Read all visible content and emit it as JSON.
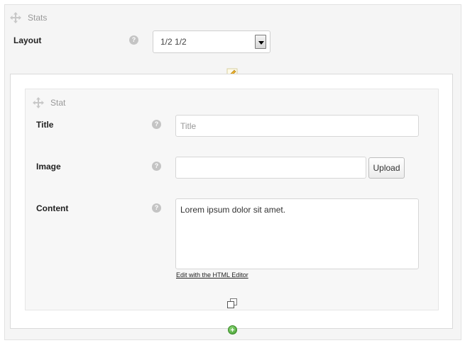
{
  "stats_block": {
    "title": "Stats",
    "layout_label": "Layout",
    "layout_value": "1/2 1/2"
  },
  "stat_item": {
    "title": "Stat",
    "fields": {
      "title_label": "Title",
      "title_placeholder": "Title",
      "image_label": "Image",
      "image_value": "",
      "upload_label": "Upload",
      "content_label": "Content",
      "content_value": "Lorem ipsum dolor sit amet.",
      "editor_link": "Edit with the HTML Editor"
    }
  },
  "icons": {
    "move": "move-arrows-icon",
    "help": "help-question-icon",
    "edit": "pencil-edit-icon",
    "duplicate": "duplicate-icon",
    "add": "add-circle-icon"
  },
  "colors": {
    "add_green": "#3f9a2c",
    "panel_bg": "#f5f5f5",
    "help_grey": "#c4c4c4"
  }
}
